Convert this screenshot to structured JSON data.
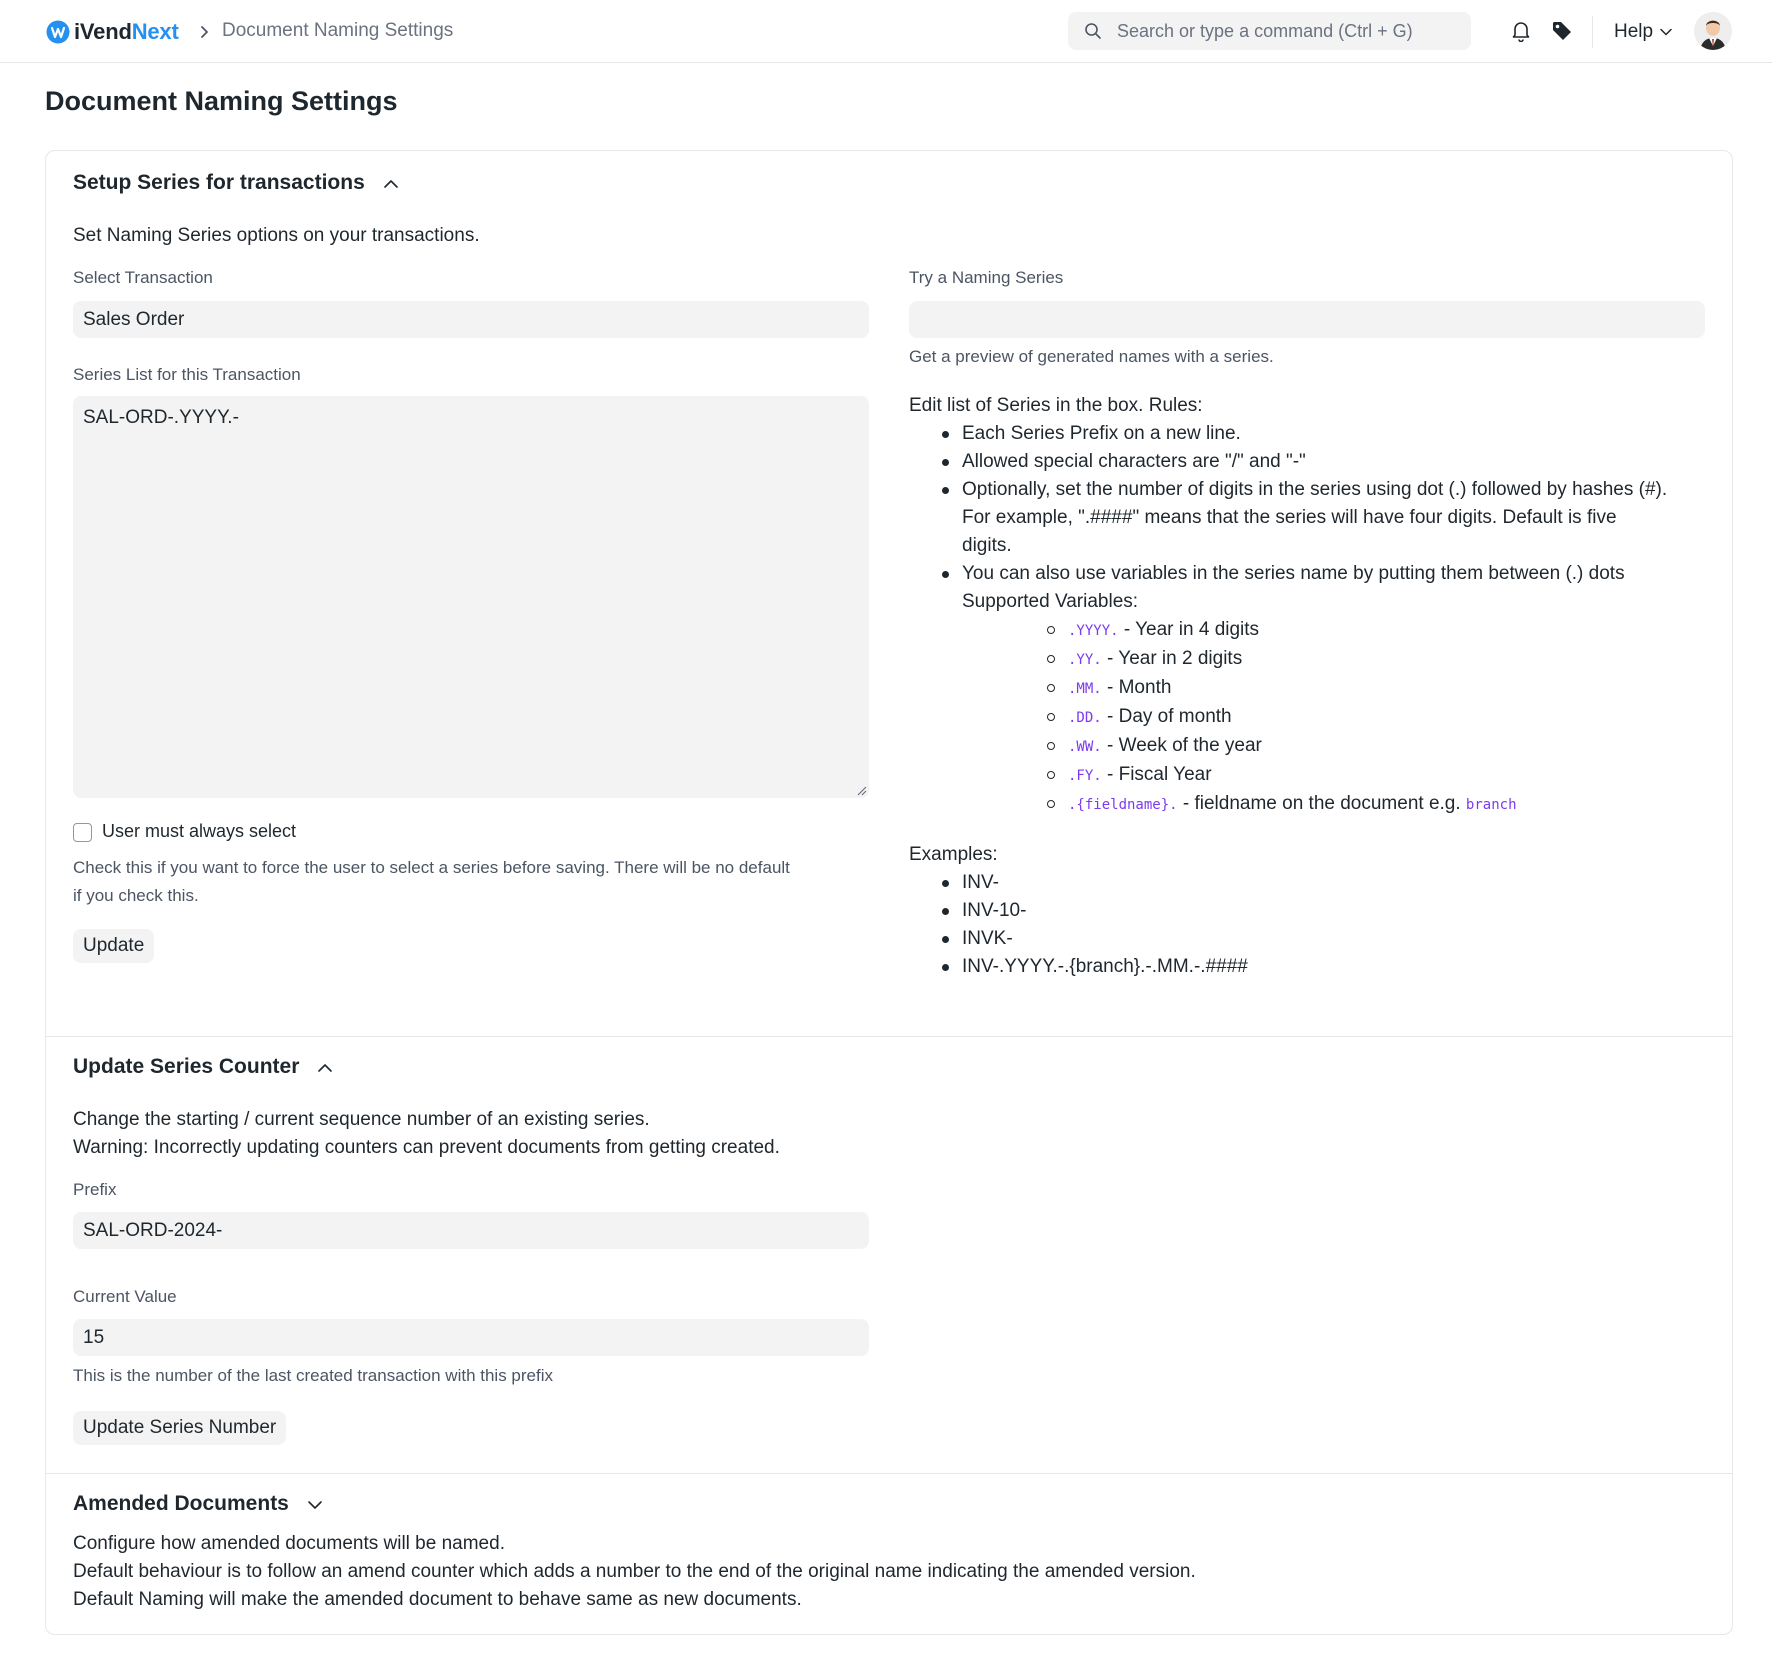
{
  "navbar": {
    "brand_prefix": "iVend",
    "brand_suffix": "Next",
    "breadcrumb": "Document Naming Settings",
    "search_placeholder": "Search or type a command (Ctrl + G)",
    "help_label": "Help"
  },
  "page": {
    "title": "Document Naming Settings"
  },
  "setup_section": {
    "title": "Setup Series for transactions",
    "description": "Set Naming Series options on your transactions.",
    "select_transaction_label": "Select Transaction",
    "select_transaction_value": "Sales Order",
    "series_list_label": "Series List for this Transaction",
    "series_list_value": "SAL-ORD-.YYYY.-",
    "user_must_select_label": "User must always select",
    "user_must_select_checked": false,
    "user_must_select_help_1": "Check this if you want to force the user to select a series before saving. There will be no default",
    "user_must_select_help_2": "if you check this.",
    "update_button": "Update",
    "try_series_label": "Try a Naming Series",
    "try_series_value": "",
    "try_series_help": "Get a preview of generated names with a series.",
    "rules_intro": "Edit list of Series in the box. Rules:",
    "rules": [
      "Each Series Prefix on a new line.",
      "Allowed special characters are \"/\" and \"-\"",
      "Optionally, set the number of digits in the series using dot (.) followed by hashes (#).",
      "For example, \".####\" means that the series will have four digits. Default is five",
      "digits.",
      "You can also use variables in the series name by putting them between (.) dots",
      "Supported Variables:"
    ],
    "variables": [
      {
        "code": ".YYYY.",
        "desc": " - Year in 4 digits"
      },
      {
        "code": ".YY.",
        "desc": " - Year in 2 digits"
      },
      {
        "code": ".MM.",
        "desc": " - Month"
      },
      {
        "code": ".DD.",
        "desc": " - Day of month"
      },
      {
        "code": ".WW.",
        "desc": " - Week of the year"
      },
      {
        "code": ".FY.",
        "desc": " - Fiscal Year"
      },
      {
        "code": ".{fieldname}.",
        "desc": " - fieldname on the document e.g. ",
        "extra_code": "branch"
      }
    ],
    "examples_label": "Examples:",
    "examples": [
      "INV-",
      "INV-10-",
      "INVK-",
      "INV-.YYYY.-.{branch}.-.MM.-.####"
    ]
  },
  "counter_section": {
    "title": "Update Series Counter",
    "description_1": "Change the starting / current sequence number of an existing series.",
    "description_2": "Warning: Incorrectly updating counters can prevent documents from getting created.",
    "prefix_label": "Prefix",
    "prefix_value": "SAL-ORD-2024-",
    "current_value_label": "Current Value",
    "current_value": "15",
    "current_value_help": "This is the number of the last created transaction with this prefix",
    "update_button": "Update Series Number"
  },
  "amended_section": {
    "title": "Amended Documents",
    "line_1": "Configure how amended documents will be named.",
    "line_2": "Default behaviour is to follow an amend counter which adds a number to the end of the original name indicating the amended version.",
    "line_3": "Default Naming will make the amended document to behave same as new documents."
  },
  "icons": {
    "logo": "ivend-logo-icon",
    "breadcrumb_separator": "chevron-right-icon",
    "search": "search-icon",
    "notifications": "bell-icon",
    "tags": "tag-icon",
    "help_dropdown": "chevron-down-icon",
    "section_collapse": "chevron-up-icon",
    "section_expand": "chevron-down-icon"
  },
  "colors": {
    "accent": "#2490ef",
    "code": "#7c3aed",
    "input_bg": "#f3f3f3",
    "text": "#1f272e",
    "muted": "#4b5563"
  }
}
